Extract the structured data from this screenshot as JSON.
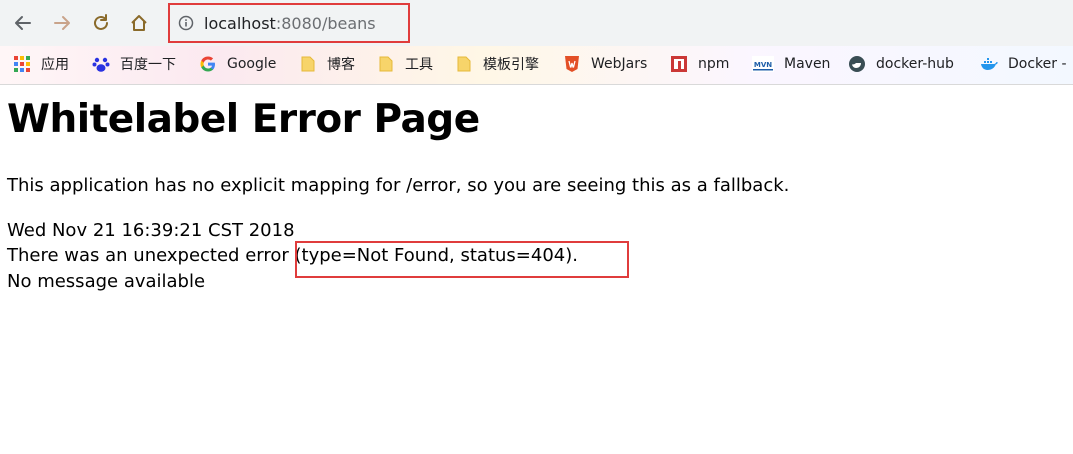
{
  "browser": {
    "url_host": "localhost",
    "url_rest": ":8080/beans",
    "bookmarks": [
      {
        "label": "应用",
        "icon": "apps-grid-icon"
      },
      {
        "label": "百度一下",
        "icon": "baidu-paw-icon"
      },
      {
        "label": "Google",
        "icon": "google-g-icon"
      },
      {
        "label": "博客",
        "icon": "folder-icon"
      },
      {
        "label": "工具",
        "icon": "folder-icon"
      },
      {
        "label": "模板引擎",
        "icon": "folder-icon"
      },
      {
        "label": "WebJars",
        "icon": "webjars-shield-icon"
      },
      {
        "label": "npm",
        "icon": "npm-icon"
      },
      {
        "label": "Maven",
        "icon": "maven-mvn-icon"
      },
      {
        "label": "docker-hub",
        "icon": "docker-hub-icon"
      },
      {
        "label": "Docker -",
        "icon": "docker-whale-icon"
      }
    ]
  },
  "page": {
    "title": "Whitelabel Error Page",
    "message": "This application has no explicit mapping for /error, so you are seeing this as a fallback.",
    "timestamp": "Wed Nov 21 16:39:21 CST 2018",
    "error_line": "There was an unexpected error (type=Not Found, status=404).",
    "detail": "No message available"
  },
  "colors": {
    "annotation_border": "#e03c3c",
    "toolbar_bg": "#f1f3f4"
  }
}
